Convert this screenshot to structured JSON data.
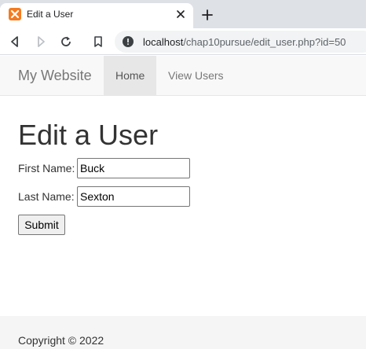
{
  "browser": {
    "tab_title": "Edit a User",
    "url_host": "localhost",
    "url_path": "/chap10pursue/edit_user.php?id=50"
  },
  "site": {
    "brand": "My Website",
    "nav": [
      {
        "label": "Home",
        "active": true
      },
      {
        "label": "View Users",
        "active": false
      }
    ]
  },
  "form": {
    "title": "Edit a User",
    "first_name_label": "First Name:",
    "first_name_value": "Buck",
    "last_name_label": "Last Name:",
    "last_name_value": "Sexton",
    "submit_label": "Submit"
  },
  "footer": {
    "text": "Copyright © 2022"
  },
  "colors": {
    "favicon": "#f47b20",
    "navbar_bg": "#f8f8f8",
    "nav_active_bg": "#e7e7e7",
    "footer_bg": "#f5f5f5"
  }
}
